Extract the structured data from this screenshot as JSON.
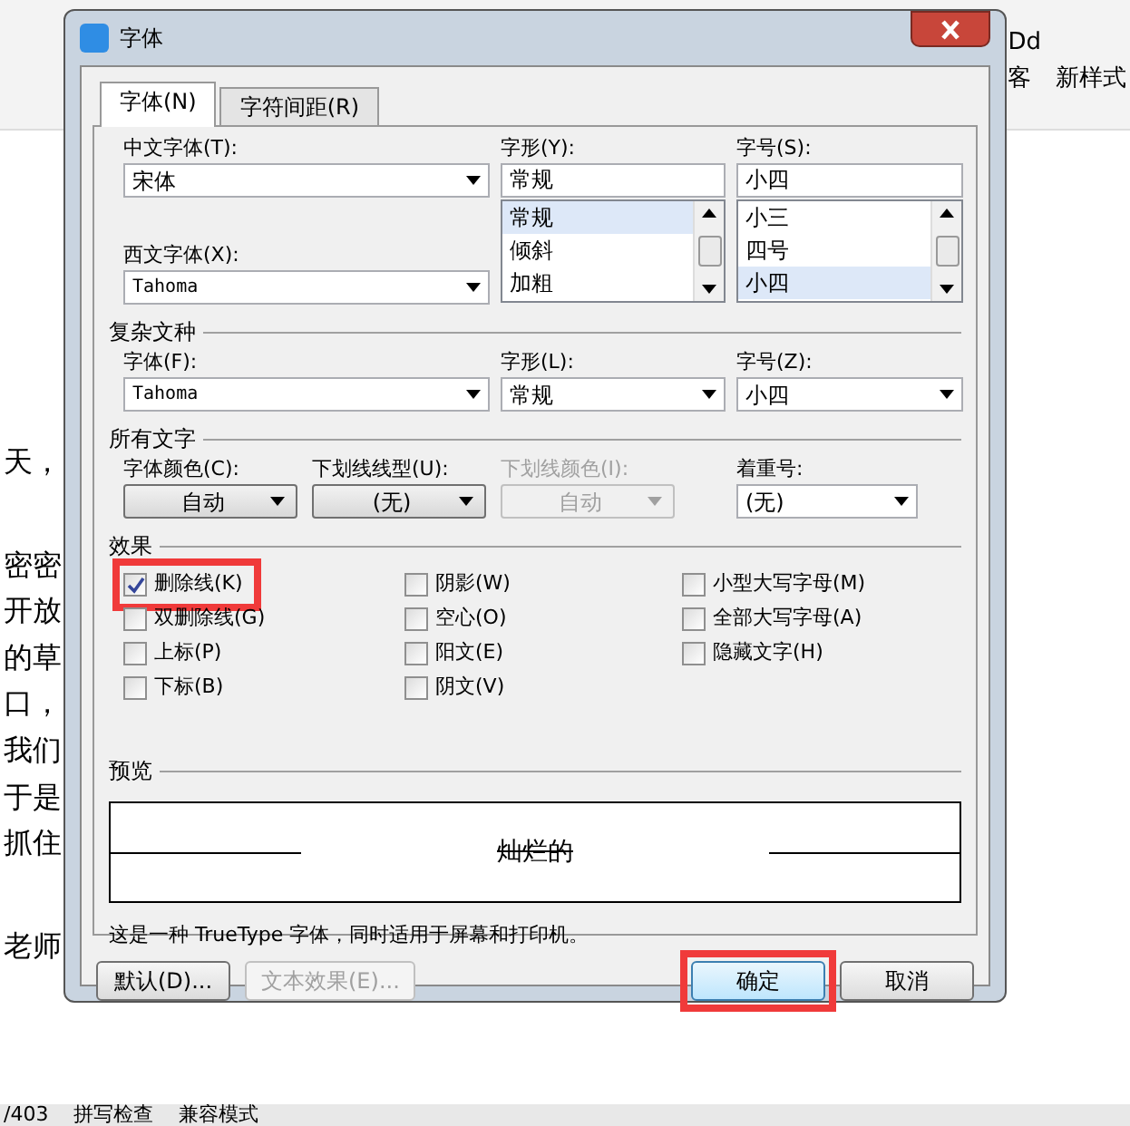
{
  "background": {
    "ribbon_right": [
      "Dd",
      "客",
      "新样式"
    ],
    "paragraphs": [
      [
        "天，"
      ],
      [
        "密密",
        "开放",
        "的草",
        "口，",
        "我们",
        "于是",
        "抓住"
      ],
      [
        "老师"
      ]
    ],
    "status_bar": [
      "/403",
      "拼写检查",
      "兼容模式"
    ]
  },
  "dialog": {
    "title": "字体",
    "tabs": [
      {
        "label": "字体(N)",
        "selected": true
      },
      {
        "label": "字符间距(R)",
        "selected": false
      }
    ],
    "chinese_font": {
      "label": "中文字体(T):",
      "value": "宋体"
    },
    "western_font": {
      "label": "西文字体(X):",
      "value": "Tahoma"
    },
    "style": {
      "label": "字形(Y):",
      "value": "常规",
      "options": [
        {
          "text": "常规",
          "selected": true
        },
        {
          "text": "倾斜",
          "selected": false
        },
        {
          "text": "加粗",
          "selected": false
        }
      ]
    },
    "size": {
      "label": "字号(S):",
      "value": "小四",
      "options": [
        {
          "text": "小三",
          "selected": false
        },
        {
          "text": "四号",
          "selected": false
        },
        {
          "text": "小四",
          "selected": true
        }
      ]
    },
    "complex_script": {
      "title": "复杂文种",
      "fields": [
        {
          "label": "字体(F):",
          "value": "Tahoma",
          "kind": "select"
        },
        {
          "label": "字形(L):",
          "value": "常规",
          "kind": "select"
        },
        {
          "label": "字号(Z):",
          "value": "小四",
          "kind": "select"
        }
      ]
    },
    "all_text": {
      "title": "所有文字",
      "fields": [
        {
          "label": "字体颜色(C):",
          "value": "自动",
          "disabled": false,
          "kind": "button"
        },
        {
          "label": "下划线线型(U):",
          "value": "(无)",
          "disabled": false,
          "kind": "button"
        },
        {
          "label": "下划线颜色(I):",
          "value": "自动",
          "disabled": true,
          "kind": "button"
        },
        {
          "label": "着重号:",
          "value": "(无)",
          "disabled": false,
          "kind": "select"
        }
      ]
    },
    "effects": {
      "title": "效果",
      "options": [
        {
          "label": "删除线(K)",
          "checked": true,
          "highlighted": true
        },
        {
          "label": "阴影(W)",
          "checked": false,
          "highlighted": false
        },
        {
          "label": "小型大写字母(M)",
          "checked": false,
          "highlighted": false
        },
        {
          "label": "双删除线(G)",
          "checked": false,
          "highlighted": false
        },
        {
          "label": "空心(O)",
          "checked": false,
          "highlighted": false
        },
        {
          "label": "全部大写字母(A)",
          "checked": false,
          "highlighted": false
        },
        {
          "label": "上标(P)",
          "checked": false,
          "highlighted": false
        },
        {
          "label": "阳文(E)",
          "checked": false,
          "highlighted": false
        },
        {
          "label": "隐藏文字(H)",
          "checked": false,
          "highlighted": false
        },
        {
          "label": "下标(B)",
          "checked": false,
          "highlighted": false
        },
        {
          "label": "阴文(V)",
          "checked": false,
          "highlighted": false
        }
      ]
    },
    "preview": {
      "title": "预览",
      "sample": "灿烂的"
    },
    "note": "这是一种 TrueType 字体，同时适用于屏幕和打印机。",
    "buttons": [
      {
        "label": "默认(D)...",
        "disabled": false,
        "default": false,
        "highlighted": false
      },
      {
        "label": "文本效果(E)...",
        "disabled": true,
        "default": false,
        "highlighted": false
      },
      {
        "label": "确定",
        "disabled": false,
        "default": true,
        "highlighted": true
      },
      {
        "label": "取消",
        "disabled": false,
        "default": false,
        "highlighted": false
      }
    ]
  }
}
